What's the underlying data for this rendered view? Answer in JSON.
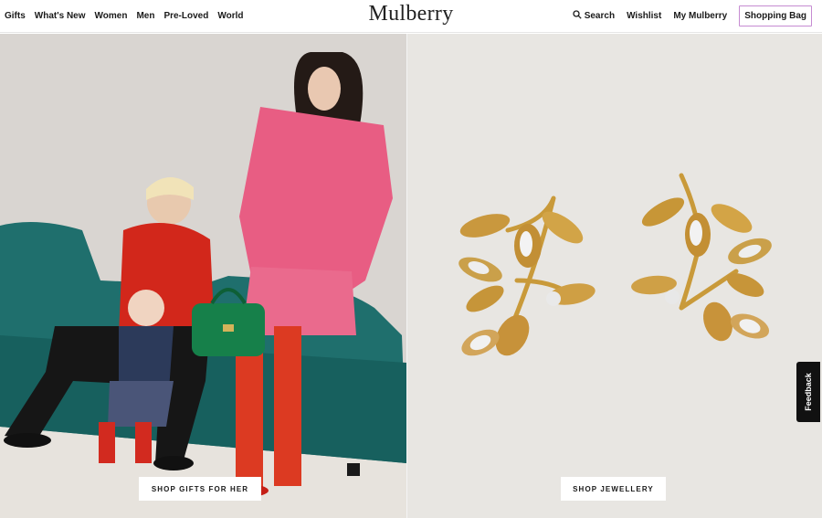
{
  "header": {
    "nav_left": [
      {
        "label": "Gifts"
      },
      {
        "label": "What's New"
      },
      {
        "label": "Women"
      },
      {
        "label": "Men"
      },
      {
        "label": "Pre-Loved"
      },
      {
        "label": "World"
      }
    ],
    "logo": "Mulberry",
    "search_label": "Search",
    "search_icon": "search-icon",
    "wishlist_label": "Wishlist",
    "account_label": "My Mulberry",
    "bag_label": "Shopping Bag",
    "bag_outline_color": "#c68bd2"
  },
  "hero": {
    "left_cta": "SHOP GIFTS FOR HER",
    "right_cta": "SHOP JEWELLERY"
  },
  "feedback_label": "Feedback"
}
